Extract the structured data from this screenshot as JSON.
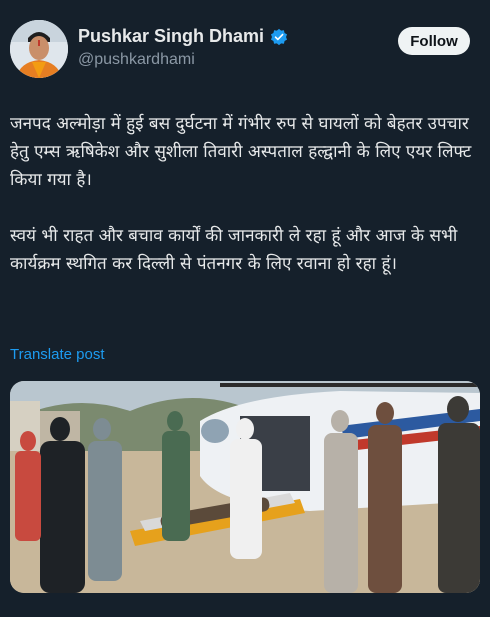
{
  "author": {
    "display_name": "Pushkar Singh Dhami",
    "handle": "@pushkardhami",
    "verified_icon": "verified-badge-icon",
    "avatar_icon": "profile-avatar"
  },
  "follow_label": "Follow",
  "post": {
    "text": "जनपद अल्मोड़ा में हुई बस दुर्घटना में गंभीर रुप से घायलों को बेहतर उपचार हेतु एम्स ऋषिकेश और सुशीला तिवारी अस्पताल हल्द्वानी के लिए एयर लिफ्ट किया गया है।\n\nस्वयं भी राहत और बचाव कार्यों की जानकारी ले रहा हूं और आज के सभी कार्यक्रम स्थगित कर दिल्ली से पंतनगर के लिए रवाना हो रहा हूं।"
  },
  "translate_label": "Translate post",
  "media": {
    "description_icon": "helicopter-evacuation-photo"
  },
  "colors": {
    "background": "#15202b",
    "text": "#e7e9ea",
    "muted": "#8b98a5",
    "link": "#1d9bf0",
    "verified": "#1d9bf0"
  }
}
